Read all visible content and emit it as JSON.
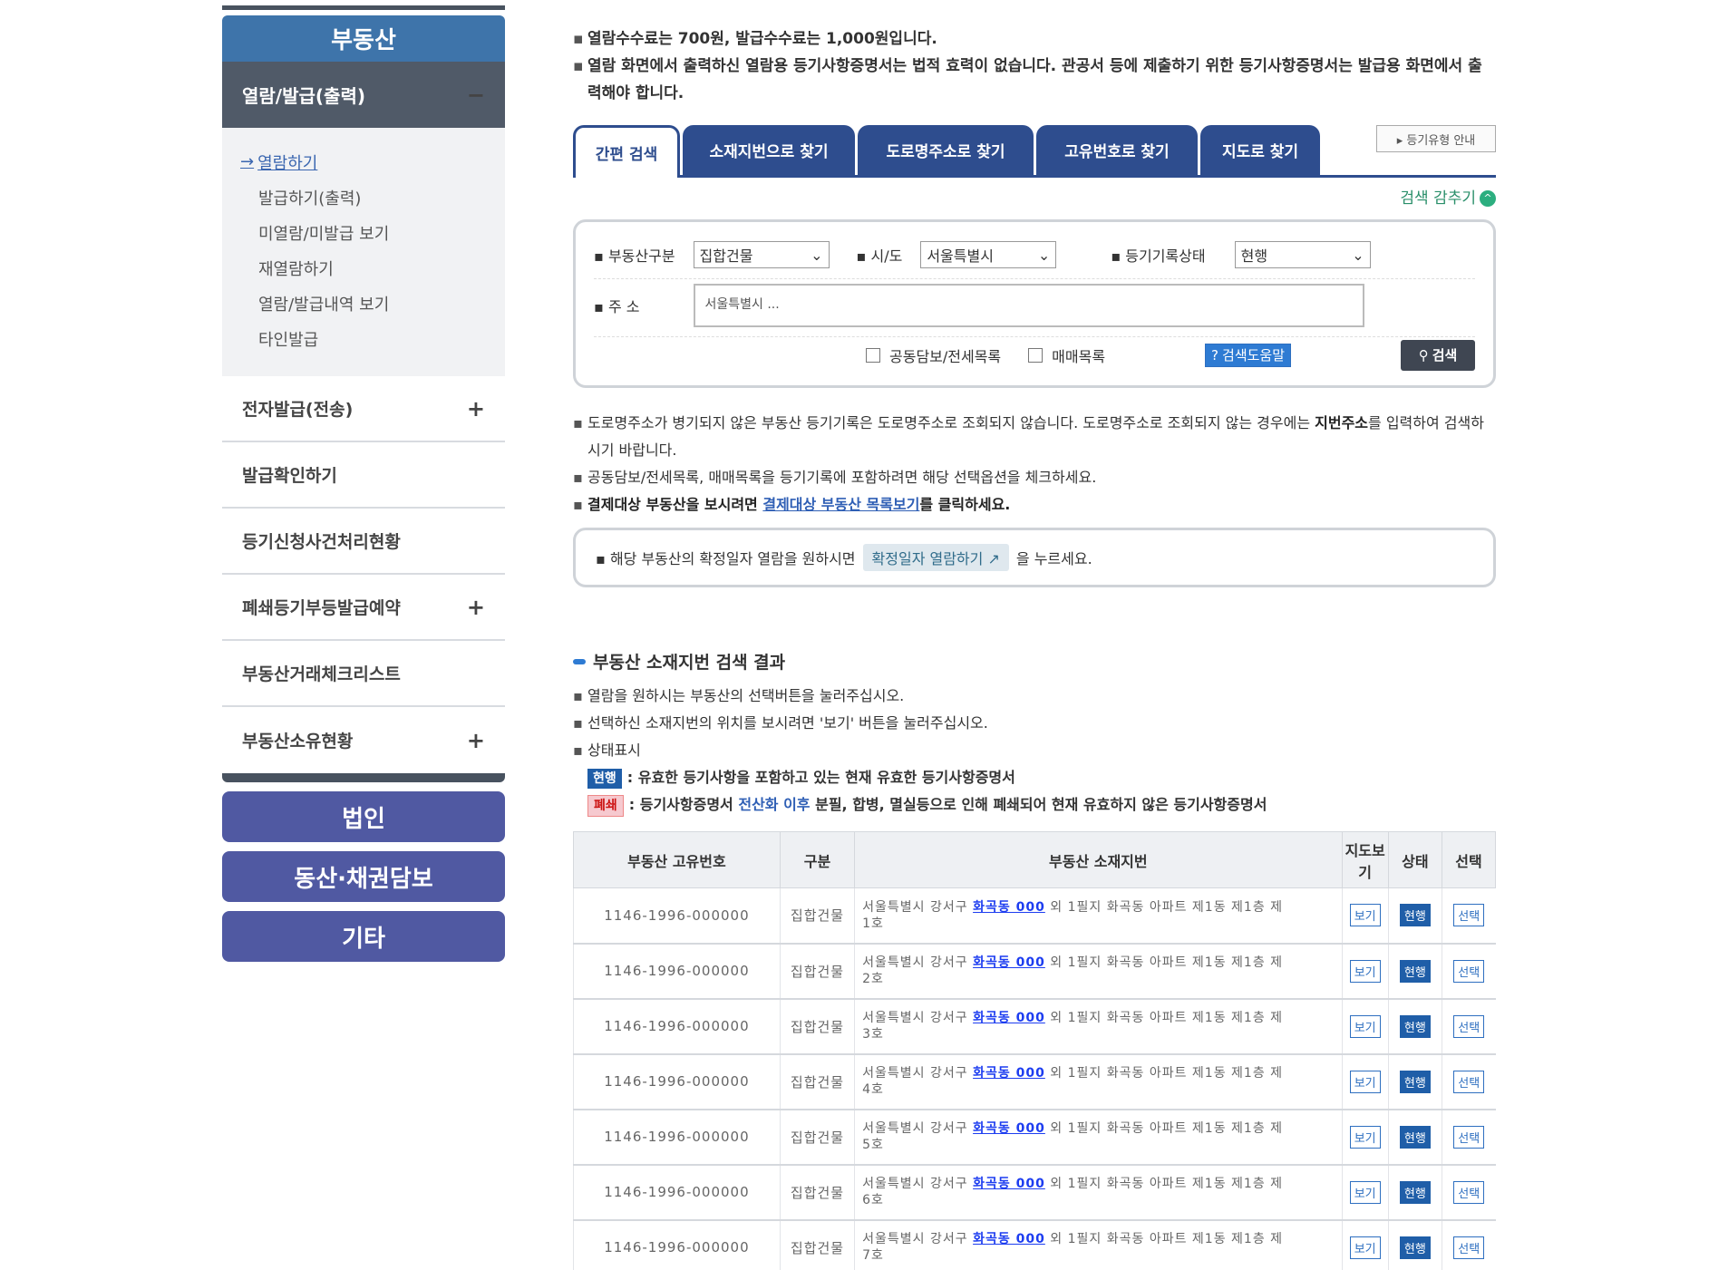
{
  "sidebar": {
    "title": "부동산",
    "group_head": "열람/발급(출력)",
    "group_toggle": "−",
    "sub_items": [
      {
        "label": "열람하기",
        "active": true
      },
      {
        "label": "발급하기(출력)"
      },
      {
        "label": "미열람/미발급 보기"
      },
      {
        "label": "재열람하기"
      },
      {
        "label": "열람/발급내역 보기"
      },
      {
        "label": "타인발급"
      }
    ],
    "items": [
      {
        "label": "전자발급(전송)",
        "toggle": "+"
      },
      {
        "label": "발급확인하기",
        "toggle": ""
      },
      {
        "label": "등기신청사건처리현황",
        "toggle": ""
      },
      {
        "label": "폐쇄등기부등발급예약",
        "toggle": "+"
      },
      {
        "label": "부동산거래체크리스트",
        "toggle": ""
      },
      {
        "label": "부동산소유현황",
        "toggle": "+"
      }
    ],
    "buttons": [
      "법인",
      "동산·채권담보",
      "기타"
    ]
  },
  "notices": [
    "열람수수료는 700원, 발급수수료는 1,000원입니다.",
    "열람 화면에서 출력하신 열람용 등기사항증명서는 법적 효력이 없습니다. 관공서 등에 제출하기 위한 등기사항증명서는 발급용 화면에서 출력해야 합니다."
  ],
  "tabs": [
    "간편 검색",
    "소재지번으로 찾기",
    "도로명주소로 찾기",
    "고유번호로 찾기",
    "지도로 찾기"
  ],
  "reg_guide": "▸ 등기유형 안내",
  "collapse_label": "검색 감추기",
  "collapse_icon": "^",
  "search": {
    "type_label": "부동산구분",
    "type_value": "집합건물",
    "city_label": "시/도",
    "city_value": "서울특별시",
    "status_label": "등기기록상태",
    "status_value": "현행",
    "addr_label": "주 소",
    "addr_value": "서울특별시 ...",
    "check1": "공동담보/전세목록",
    "check2": "매매목록",
    "help": "검색도움말",
    "help_icon": "?",
    "submit": "검색"
  },
  "notes2": {
    "n1": "도로명주소가 병기되지 않은 부동산 등기기록은 도로명주소로 조회되지 않습니다. 도로명주소로 조회되지 않는 경우에는",
    "n1_bold": "지번주소",
    "n1_end": "를 입력하여 검색하시기 바랍니다.",
    "n2": "공동담보/전세목록, 매매목록을 등기기록에 포함하려면 해당 선택옵션을 체크하세요.",
    "n3_pre": "결제대상 부동산을 보시려면",
    "n3_link": "결제대상 부동산 목록보기",
    "n3_post": "를 클릭하세요."
  },
  "confirm": {
    "pre": "해당 부동산의 확정일자 열람을 원하시면",
    "btn": "확정일자 열람하기",
    "post": "을 누르세요."
  },
  "result": {
    "title": "부동산 소재지번 검색 결과",
    "n1": "열람을 원하시는 부동산의 선택버튼을 눌러주십시오.",
    "n2": "선택하신 소재지번의 위치를 보시려면 '보기' 버튼을 눌러주십시오.",
    "n3": "상태표시",
    "tag_cur": "현행",
    "tag_cur_desc": ": 유효한 등기사항을 포함하고 있는 현재 유효한 등기사항증명서",
    "tag_closed": "폐쇄",
    "tag_closed_desc_pre": ": 등기사항증명서",
    "tag_closed_desc_blue": "전산화 이후",
    "tag_closed_desc_post": "분필, 합병, 멸실등으로 인해 폐쇄되어 현재 유효하지 않은 등기사항증명서",
    "headers": [
      "부동산 고유번호",
      "구분",
      "부동산 소재지번",
      "지도보기",
      "상태",
      "선택"
    ],
    "rows": [
      {
        "id": "1146-1996-000000",
        "kind": "집합건물",
        "addr1": "서울특별시 강서구",
        "hl": "화곡동 000",
        "addr2": "외 1필지 화곡동 아파트 제1동 제1층 제",
        "addr3": "1호"
      },
      {
        "id": "1146-1996-000000",
        "kind": "집합건물",
        "addr1": "서울특별시 강서구",
        "hl": "화곡동 000",
        "addr2": "외 1필지 화곡동 아파트 제1동 제1층 제",
        "addr3": "2호"
      },
      {
        "id": "1146-1996-000000",
        "kind": "집합건물",
        "addr1": "서울특별시 강서구",
        "hl": "화곡동 000",
        "addr2": "외 1필지 화곡동 아파트 제1동 제1층 제",
        "addr3": "3호"
      },
      {
        "id": "1146-1996-000000",
        "kind": "집합건물",
        "addr1": "서울특별시 강서구",
        "hl": "화곡동 000",
        "addr2": "외 1필지 화곡동 아파트 제1동 제1층 제",
        "addr3": "4호"
      },
      {
        "id": "1146-1996-000000",
        "kind": "집합건물",
        "addr1": "서울특별시 강서구",
        "hl": "화곡동 000",
        "addr2": "외 1필지 화곡동 아파트 제1동 제1층 제",
        "addr3": "5호"
      },
      {
        "id": "1146-1996-000000",
        "kind": "집합건물",
        "addr1": "서울특별시 강서구",
        "hl": "화곡동 000",
        "addr2": "외 1필지 화곡동 아파트 제1동 제1층 제",
        "addr3": "6호"
      },
      {
        "id": "1146-1996-000000",
        "kind": "집합건물",
        "addr1": "서울특별시 강서구",
        "hl": "화곡동 000",
        "addr2": "외 1필지 화곡동 아파트 제1동 제1층 제",
        "addr3": "7호"
      }
    ],
    "btn_view": "보기",
    "btn_state": "현행",
    "btn_select": "선택"
  }
}
